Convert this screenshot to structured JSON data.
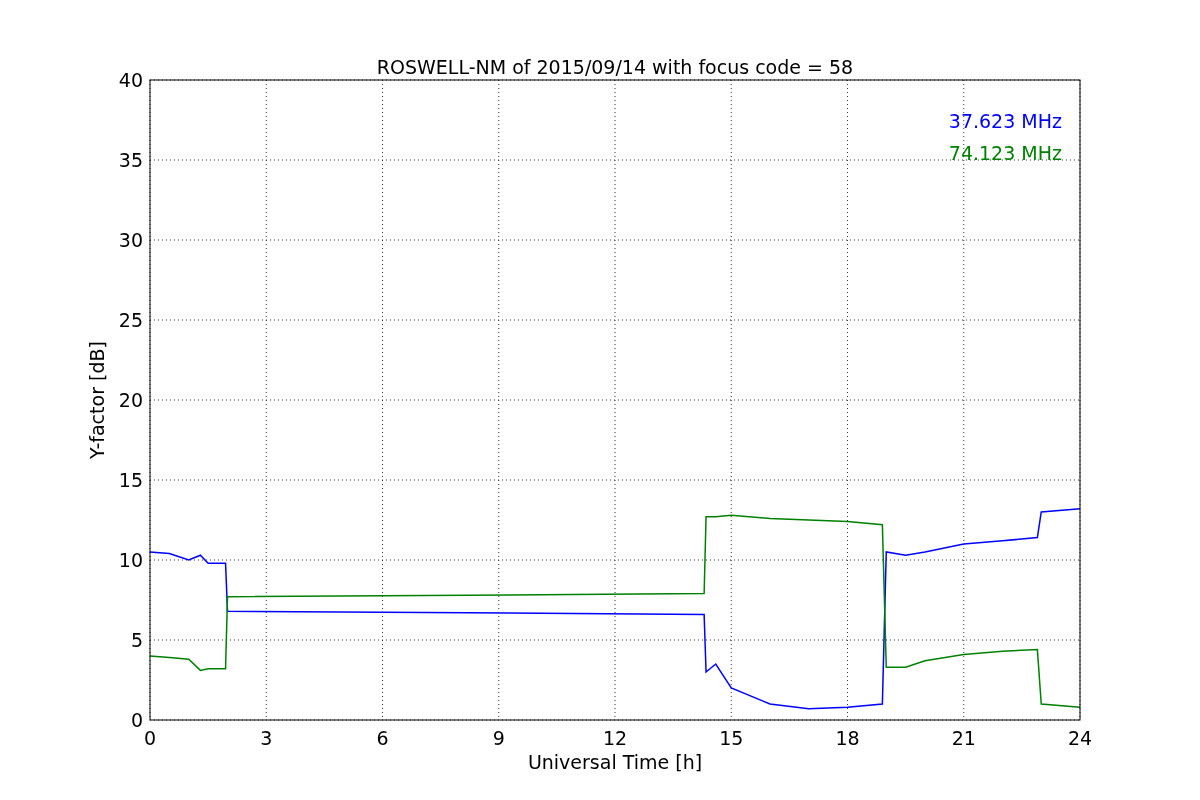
{
  "chart_data": {
    "type": "line",
    "title": "ROSWELL-NM of 2015/09/14 with focus code = 58",
    "xlabel": "Universal Time [h]",
    "ylabel": "Y-factor [dB]",
    "x": [
      0,
      0.5,
      1,
      1.3,
      1.5,
      1.95,
      2,
      14.3,
      14.35,
      14.6,
      15,
      16,
      17,
      18,
      18.9,
      19,
      19.5,
      20,
      21,
      22,
      22.9,
      23,
      24
    ],
    "series": [
      {
        "name": "37.623 MHz",
        "color": "#0000ff",
        "values": [
          10.5,
          10.4,
          10,
          10.3,
          9.8,
          9.8,
          6.8,
          6.6,
          3,
          3.5,
          2,
          1,
          0.7,
          0.8,
          1,
          10.5,
          10.3,
          10.5,
          11,
          11.2,
          11.4,
          13,
          13.2
        ]
      },
      {
        "name": "74.123 MHz",
        "color": "#008000",
        "values": [
          4,
          3.9,
          3.8,
          3.1,
          3.2,
          3.2,
          7.7,
          7.9,
          12.7,
          12.7,
          12.8,
          12.6,
          12.5,
          12.4,
          12.2,
          3.3,
          3.3,
          3.7,
          4.1,
          4.3,
          4.4,
          1,
          0.8
        ]
      }
    ],
    "xlim": [
      0,
      24
    ],
    "ylim": [
      0,
      40
    ],
    "xticks": [
      0,
      3,
      6,
      9,
      12,
      15,
      18,
      21,
      24
    ],
    "yticks": [
      0,
      5,
      10,
      15,
      20,
      25,
      30,
      35,
      40
    ],
    "grid": true
  }
}
